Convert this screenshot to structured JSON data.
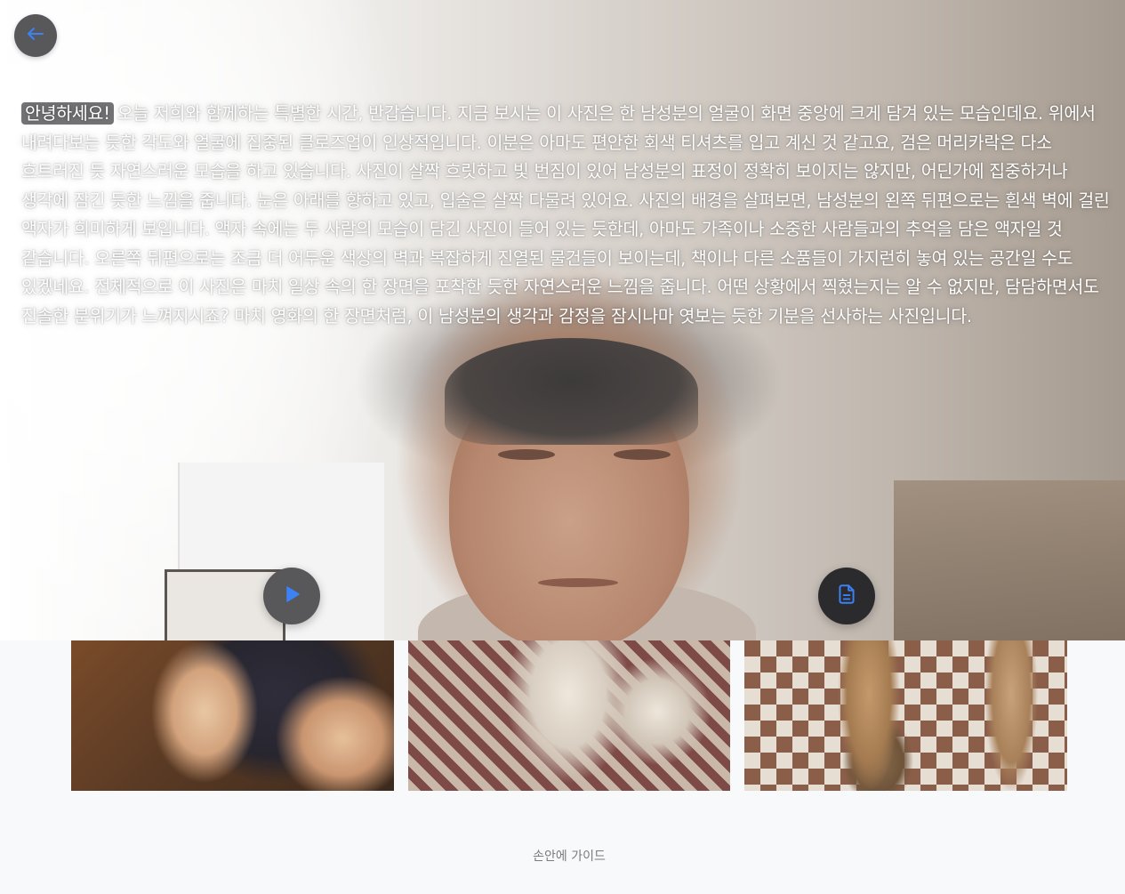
{
  "nav": {
    "back_icon": "arrow-left-icon",
    "back_icon_color": "#3b82f6"
  },
  "narration": {
    "highlight": "안녕하세요!",
    "text": "오늘 저희와 함께하는 특별한 시간, 반갑습니다. 지금 보시는 이 사진은 한 남성분의 얼굴이 화면 중앙에 크게 담겨 있는 모습인데요. 위에서 내려다보는 듯한 각도와 얼굴에 집중된 클로즈업이 인상적입니다. 이분은 아마도 편안한 회색 티셔츠를 입고 계신 것 같고요, 검은 머리카락은 다소 흐트러진 듯 자연스러운 모습을 하고 있습니다. 사진이 살짝 흐릿하고 빛 번짐이 있어 남성분의 표정이 정확히 보이지는 않지만, 어딘가에 집중하거나 생각에 잠긴 듯한 느낌을 줍니다. 눈은 아래를 향하고 있고, 입술은 살짝 다물려 있어요. 사진의 배경을 살펴보면, 남성분의 왼쪽 뒤편으로는 흰색 벽에 걸린 액자가 희미하게 보입니다. 액자 속에는 두 사람의 모습이 담긴 사진이 들어 있는 듯한데, 아마도 가족이나 소중한 사람들과의 추억을 담은 액자일 것 같습니다. 오른쪽 뒤편으로는 조금 더 어두운 색상의 벽과 복잡하게 진열된 물건들이 보이는데, 책이나 다른 소품들이 가지런히 놓여 있는 공간일 수도 있겠네요. 전체적으로 이 사진은 마치 일상 속의 한 장면을 포착한 듯한 자연스러운 느낌을 줍니다. 어떤 상황에서 찍혔는지는 알 수 없지만, 담담하면서도 진솔한 분위기가 느껴지시죠? 마치 영화의 한 장면처럼, 이 남성분의 생각과 감정을 잠시나마 엿보는 듯한 기분을 선사하는 사진입니다."
  },
  "controls": {
    "play_icon": "play-icon",
    "document_icon": "document-icon",
    "accent_color": "#3b82f6"
  },
  "gallery": {
    "items": [
      {
        "subject": "renaissance-painting-two-infants"
      },
      {
        "subject": "marble-statue-with-deer"
      },
      {
        "subject": "sculpture-legs-on-checkered-floor"
      }
    ]
  },
  "footer": {
    "guide_label": "손안에 가이드"
  }
}
